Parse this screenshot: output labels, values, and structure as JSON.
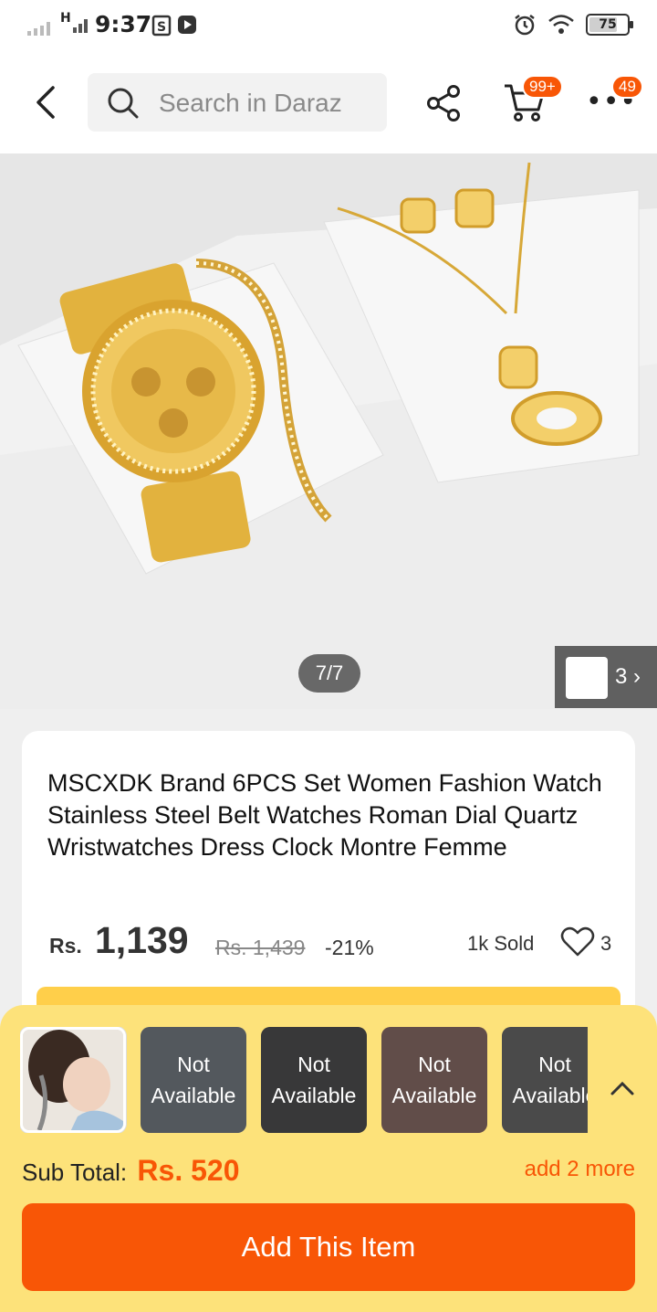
{
  "status_bar": {
    "network": "H",
    "time": "9:37",
    "battery": "75",
    "battery_level": 0.75
  },
  "header": {
    "search_placeholder": "Search in Daraz",
    "cart_badge": "99+",
    "more_badge": "49"
  },
  "gallery": {
    "counter": "7/7",
    "thumb_count": "3"
  },
  "product": {
    "title": "MSCXDK Brand 6PCS Set Women Fashion Watch Stainless Steel Belt Watches Roman Dial Quartz Wristwatches Dress Clock Montre Femme",
    "currency": "Rs.",
    "price": "1,139",
    "original_price": "Rs. 1,439",
    "discount": "-21%",
    "sold": "1k Sold",
    "likes": "3"
  },
  "bundle_sheet": {
    "variants": [
      {
        "label": "",
        "available": true
      },
      {
        "label": "Not Available",
        "available": false
      },
      {
        "label": "Not Available",
        "available": false
      },
      {
        "label": "Not Available",
        "available": false
      },
      {
        "label": "Not Available",
        "available": false
      }
    ],
    "subtotal_label": "Sub Total:",
    "subtotal_value": "Rs. 520",
    "add_more": "add 2 more",
    "add_button": "Add This Item"
  },
  "colors": {
    "accent": "#f85606",
    "sheet_bg": "#fde27a"
  }
}
